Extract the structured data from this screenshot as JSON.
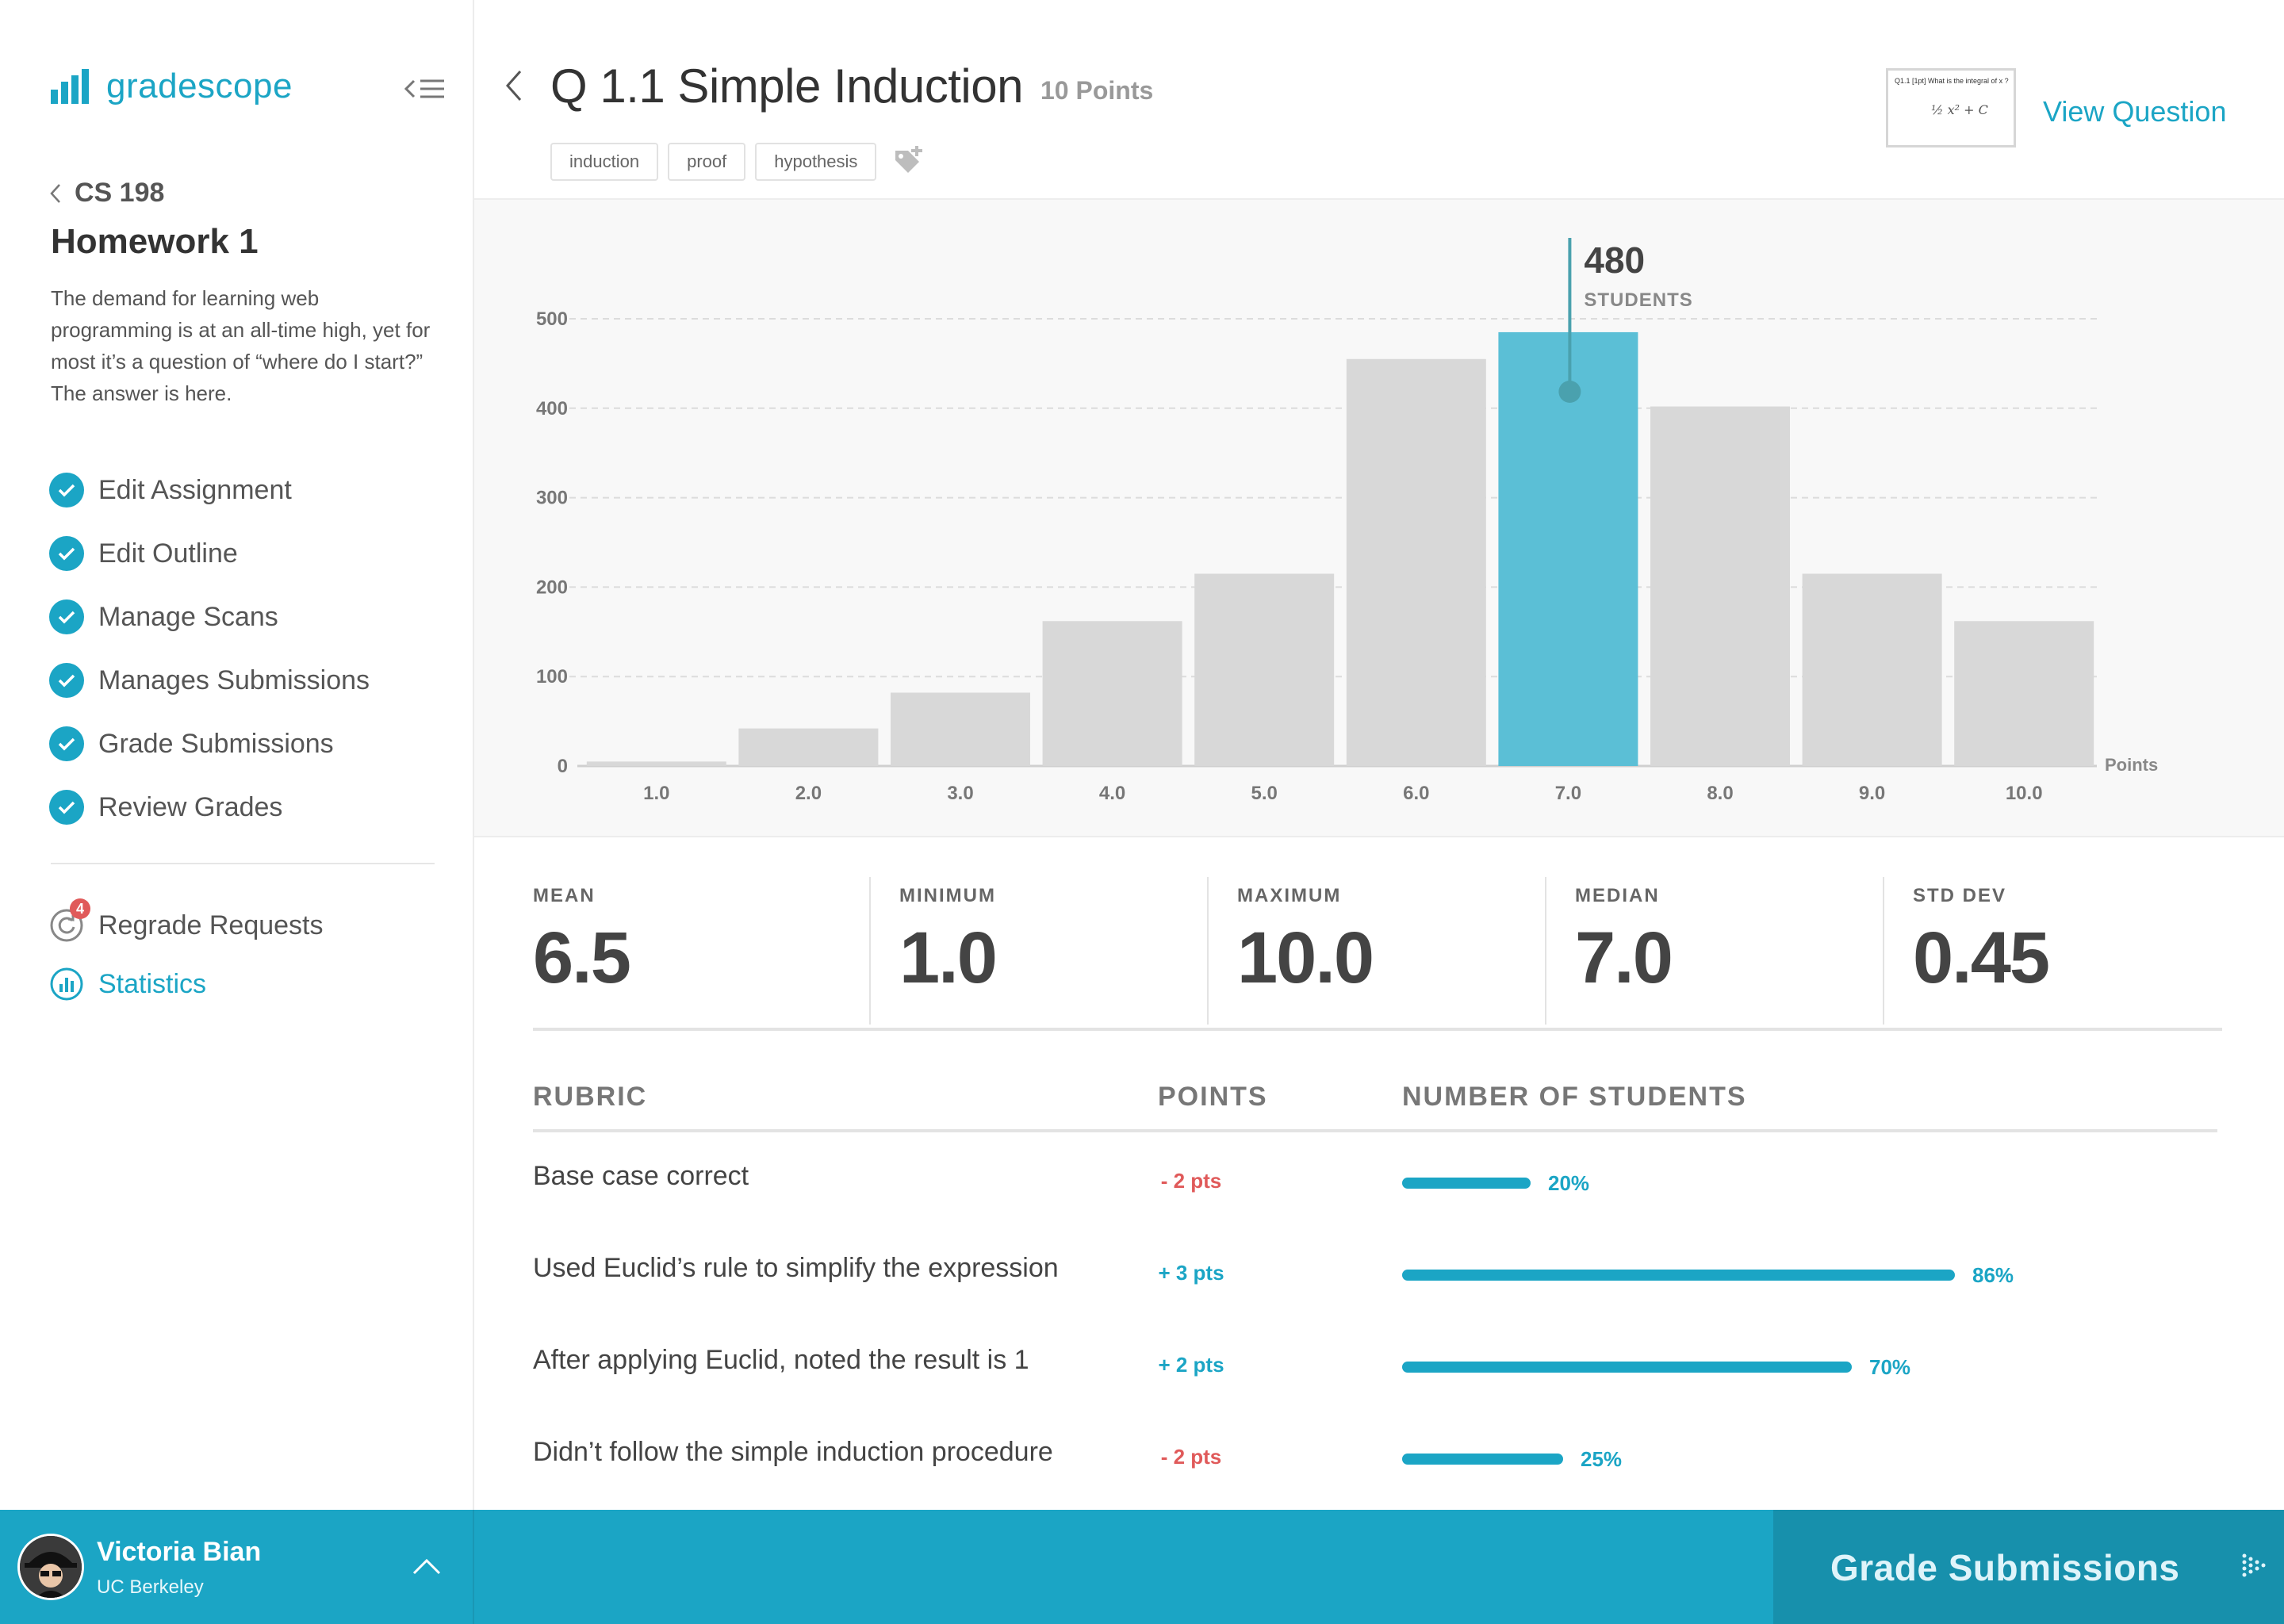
{
  "brand": {
    "name": "gradescope",
    "color": "#1ba5c5"
  },
  "sidebar": {
    "course": "CS 198",
    "assignment_title": "Homework 1",
    "description": "The demand for learning web programming is at an all-time high, yet for most it’s a question of “where do I start?” The answer is here.",
    "steps": [
      {
        "label": "Edit Assignment",
        "icon": "check-circle-icon"
      },
      {
        "label": "Edit Outline",
        "icon": "check-circle-icon"
      },
      {
        "label": "Manage Scans",
        "icon": "check-circle-icon"
      },
      {
        "label": "Manages Submissions",
        "icon": "check-circle-icon"
      },
      {
        "label": "Grade Submissions",
        "icon": "check-circle-icon"
      },
      {
        "label": "Review Grades",
        "icon": "check-circle-icon"
      }
    ],
    "regrade": {
      "label": "Regrade Requests",
      "badge": "4",
      "icon": "regrade-icon"
    },
    "statistics": {
      "label": "Statistics",
      "icon": "bar-chart-icon"
    }
  },
  "user": {
    "name": "Victoria Bian",
    "org": "UC Berkeley"
  },
  "question": {
    "title": "Q 1.1 Simple Induction",
    "points": "10 Points",
    "tags": [
      "induction",
      "proof",
      "hypothesis"
    ],
    "view_label": "View Question",
    "thumb_text": "Q1.1  [1pt] What is the integral of x ?",
    "thumb_formula": "½ x² + C"
  },
  "chart_data": {
    "type": "bar",
    "categories": [
      "1.0",
      "2.0",
      "3.0",
      "4.0",
      "5.0",
      "6.0",
      "7.0",
      "8.0",
      "9.0",
      "10.0"
    ],
    "values": [
      5,
      42,
      82,
      162,
      215,
      455,
      485,
      402,
      215,
      162
    ],
    "highlight_index": 6,
    "highlight_label": {
      "value": "480",
      "unit": "STUDENTS"
    },
    "xlabel": "Points",
    "ylim": [
      0,
      500
    ],
    "yticks": [
      "0",
      "100",
      "200",
      "300",
      "400",
      "500"
    ],
    "grid": true,
    "colors": {
      "bar": "#d8d8d8",
      "highlight": "#5bbfd6",
      "pin": "#4aa1ae"
    }
  },
  "stats": [
    {
      "label": "MEAN",
      "value": "6.5"
    },
    {
      "label": "MINIMUM",
      "value": "1.0"
    },
    {
      "label": "MAXIMUM",
      "value": "10.0"
    },
    {
      "label": "MEDIAN",
      "value": "7.0"
    },
    {
      "label": "STD DEV",
      "value": "0.45"
    }
  ],
  "rubric": {
    "headers": {
      "rubric": "RUBRIC",
      "points": "POINTS",
      "students": "NUMBER OF STUDENTS"
    },
    "items": [
      {
        "label": "Base case correct",
        "points": "- 2 pts",
        "sign": "neg",
        "pct_label": "20%",
        "pct": 20
      },
      {
        "label": "Used Euclid’s rule to simplify the expression",
        "points": "+ 3 pts",
        "sign": "pos",
        "pct_label": "86%",
        "pct": 86
      },
      {
        "label": "After applying Euclid, noted the result is 1",
        "points": "+ 2 pts",
        "sign": "pos",
        "pct_label": "70%",
        "pct": 70
      },
      {
        "label": "Didn’t follow the simple induction procedure",
        "points": "- 2 pts",
        "sign": "neg",
        "pct_label": "25%",
        "pct": 25
      }
    ]
  },
  "action": {
    "label": "Grade Submissions"
  }
}
